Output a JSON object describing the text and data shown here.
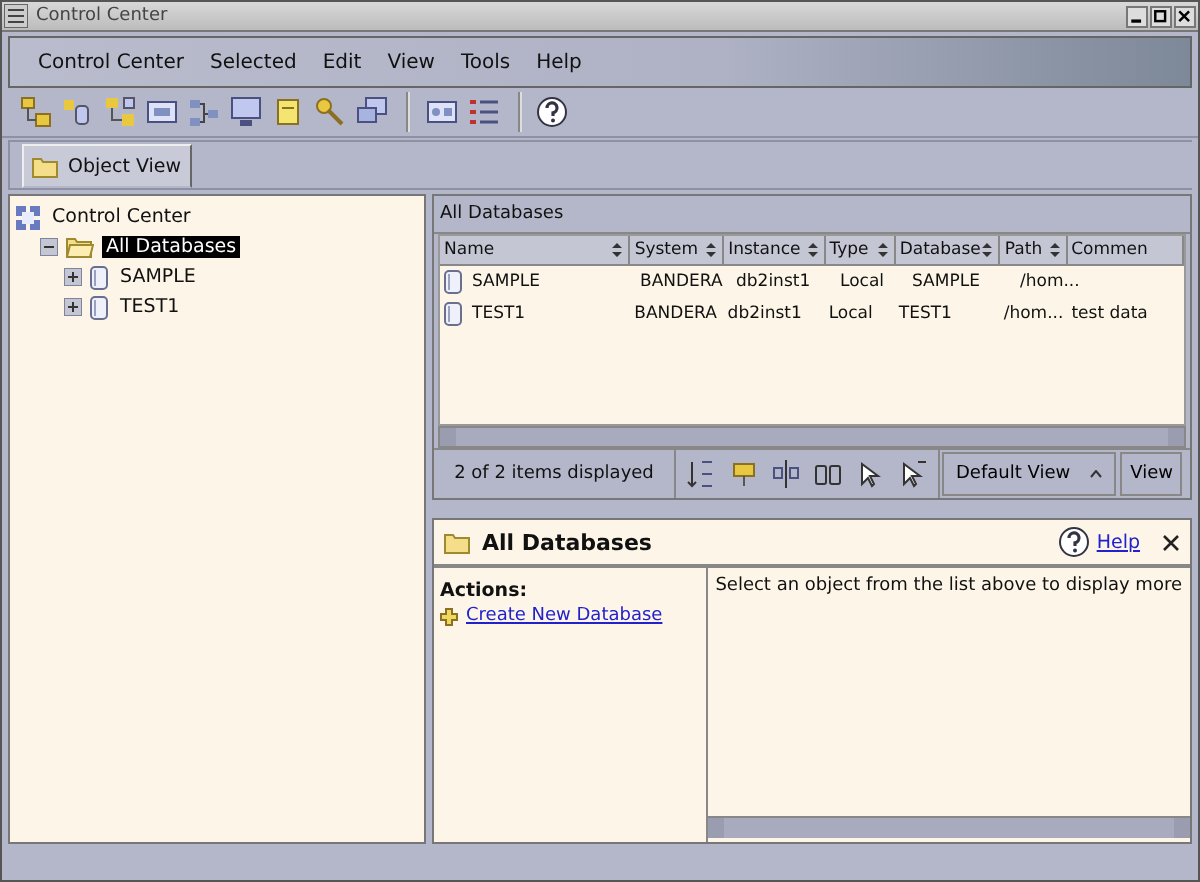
{
  "window": {
    "title": "Control Center"
  },
  "menu": [
    "Control Center",
    "Selected",
    "Edit",
    "View",
    "Tools",
    "Help"
  ],
  "tabs": [
    {
      "label": "Object View",
      "selected": true
    }
  ],
  "tree": {
    "label": "Control Center",
    "kind": "root",
    "selected": false,
    "children": [
      {
        "label": "All Databases",
        "kind": "folder",
        "selected": true,
        "expanded": true,
        "children": [
          {
            "label": "SAMPLE",
            "kind": "database",
            "selected": false,
            "expanded": false
          },
          {
            "label": "TEST1",
            "kind": "database",
            "selected": false,
            "expanded": false
          }
        ]
      }
    ]
  },
  "contents": {
    "title": "All Databases",
    "columns": [
      "Name",
      "System",
      "Instance",
      "Type",
      "Database",
      "Path",
      "Commen"
    ],
    "rows": [
      [
        "SAMPLE",
        "BANDERA",
        "db2inst1",
        "Local",
        "SAMPLE",
        "/hom..."
      ],
      [
        "TEST1",
        "BANDERA",
        "db2inst1",
        "Local",
        "TEST1",
        "/hom...",
        "test data"
      ]
    ],
    "status": "2 of 2 items displayed",
    "view_select": "Default View",
    "view_button": "View"
  },
  "details": {
    "title": "All Databases",
    "help": "Help",
    "actions_label": "Actions:",
    "actions": [
      "Create New Database"
    ],
    "message": "Select an object from the list above to display more"
  }
}
